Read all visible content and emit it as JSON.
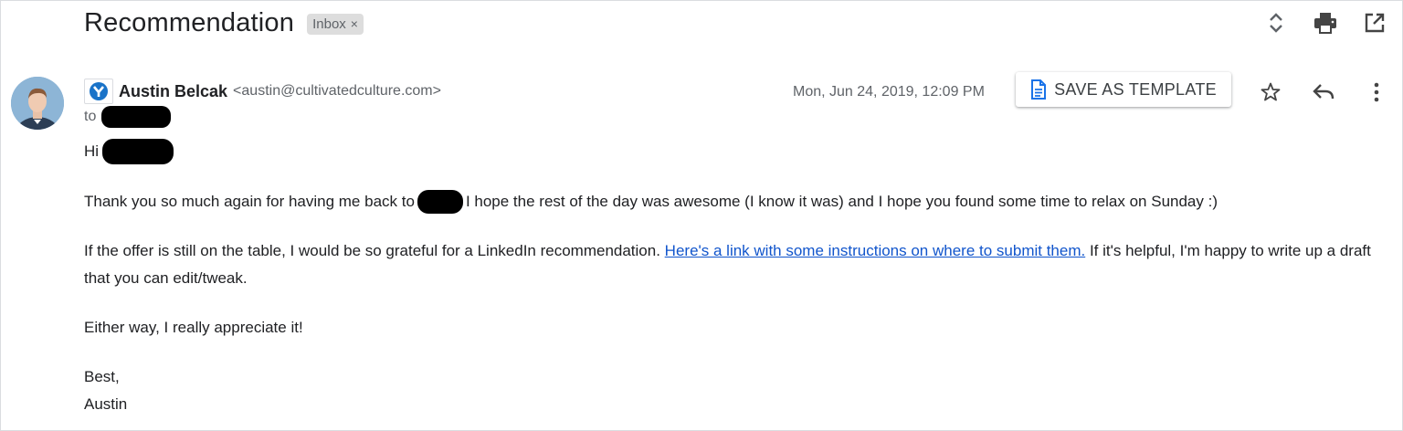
{
  "subject": "Recommendation",
  "label": {
    "text": "Inbox",
    "remove_glyph": "×"
  },
  "top_icons": [
    "expand-collapse-icon",
    "print-icon",
    "open-new-window-icon"
  ],
  "sender": {
    "name": "Austin Belcak",
    "email": "<austin@cultivatedculture.com>",
    "to_label": "to",
    "date": "Mon, Jun 24, 2019, 12:09 PM"
  },
  "save_template": {
    "label": "SAVE AS TEMPLATE",
    "icon": "document-icon"
  },
  "message_icons": [
    "star-icon",
    "reply-icon",
    "more-vert-icon"
  ],
  "body": {
    "greeting": "Hi",
    "p1_before": "Thank you so much again for having me back to",
    "p1_after": "I hope the rest of the day was awesome (I know it was) and I hope you found some time to relax on Sunday :)",
    "p2_before": "If the offer is still on the table, I would be so grateful for a LinkedIn recommendation. ",
    "p2_link": "Here's a link with some instructions on where to submit them.",
    "p2_after": " If it's helpful, I'm happy to write up a draft that you can edit/tweak.",
    "p3": "Either way, I really appreciate it!",
    "signoff": "Best,",
    "signature": "Austin"
  },
  "colors": {
    "link": "#1155cc",
    "chip_bg": "#dddddd",
    "text": "#202124",
    "muted": "#5f6368"
  }
}
